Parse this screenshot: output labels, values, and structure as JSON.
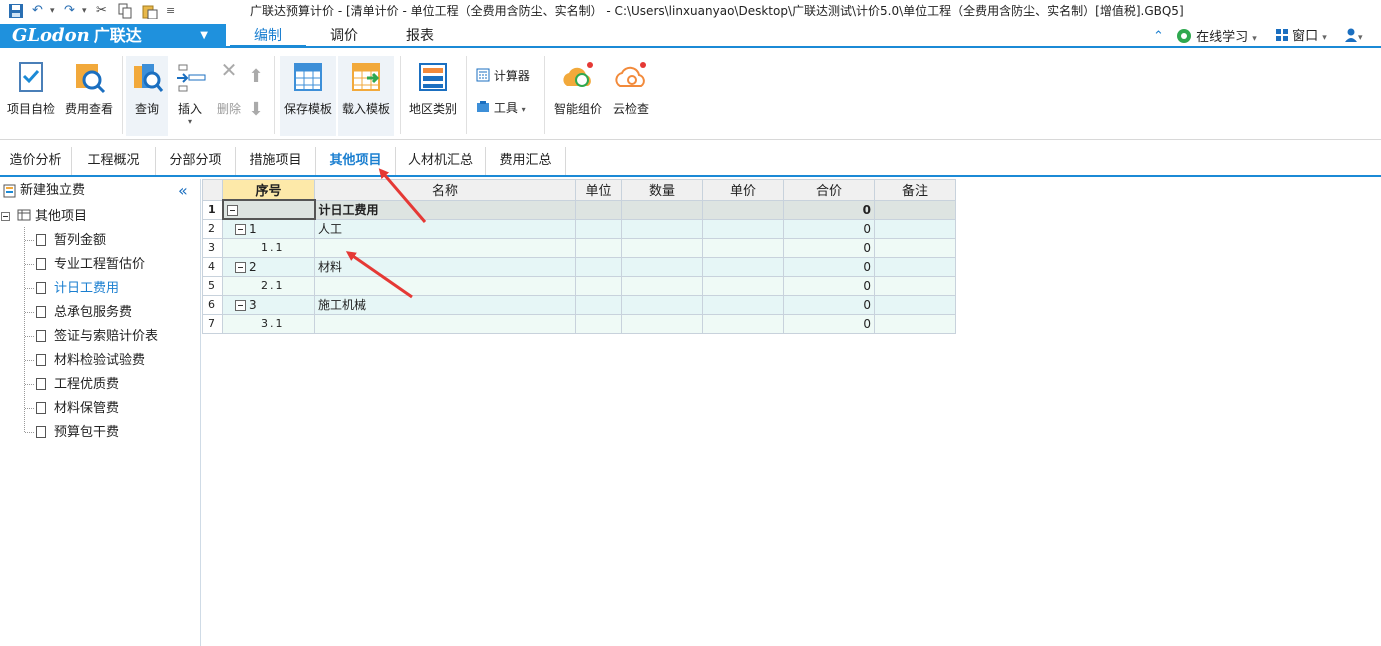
{
  "window": {
    "title": "广联达预算计价 - [清单计价 - 单位工程（全费用含防尘、实名制） - C:\\Users\\linxuanyao\\Desktop\\广联达测试\\计价5.0\\单位工程（全费用含防尘、实名制）[增值税].GBQ5]"
  },
  "brand": {
    "latin": "GLodon",
    "cn": "广联达",
    "arrow": "▼"
  },
  "menu": {
    "tabs": [
      "编制",
      "调价",
      "报表"
    ],
    "right": {
      "learn": "在线学习",
      "window": "窗口"
    }
  },
  "ribbon": {
    "buttons": [
      "项目自检",
      "费用查看",
      "查询",
      "插入",
      "删除",
      "保存模板",
      "载入模板",
      "地区类别",
      "智能组价",
      "云检查"
    ],
    "small": [
      "计算器",
      "工具"
    ]
  },
  "page_tabs": [
    "造价分析",
    "工程概况",
    "分部分项",
    "措施项目",
    "其他项目",
    "人材机汇总",
    "费用汇总"
  ],
  "sidebar": {
    "header": "新建独立费",
    "root": "其他项目",
    "items": [
      "暂列金额",
      "专业工程暂估价",
      "计日工费用",
      "总承包服务费",
      "签证与索赔计价表",
      "材料检验试验费",
      "工程优质费",
      "材料保管费",
      "预算包干费"
    ],
    "selected": "计日工费用"
  },
  "grid": {
    "columns": [
      "序号",
      "名称",
      "单位",
      "数量",
      "单价",
      "合价",
      "备注"
    ],
    "rows": [
      {
        "rn": "1",
        "seq": "",
        "name": "计日工费用",
        "total": "0"
      },
      {
        "rn": "2",
        "seq": "1",
        "name": "人工",
        "total": "0"
      },
      {
        "rn": "3",
        "seq": "1.1",
        "name": "",
        "total": "0"
      },
      {
        "rn": "4",
        "seq": "2",
        "name": "材料",
        "total": "0"
      },
      {
        "rn": "5",
        "seq": "2.1",
        "name": "",
        "total": "0"
      },
      {
        "rn": "6",
        "seq": "3",
        "name": "施工机械",
        "total": "0"
      },
      {
        "rn": "7",
        "seq": "3.1",
        "name": "",
        "total": "0"
      }
    ]
  },
  "colors": {
    "accent": "#1b8ad6",
    "annotation_arrow": "#e53935"
  }
}
